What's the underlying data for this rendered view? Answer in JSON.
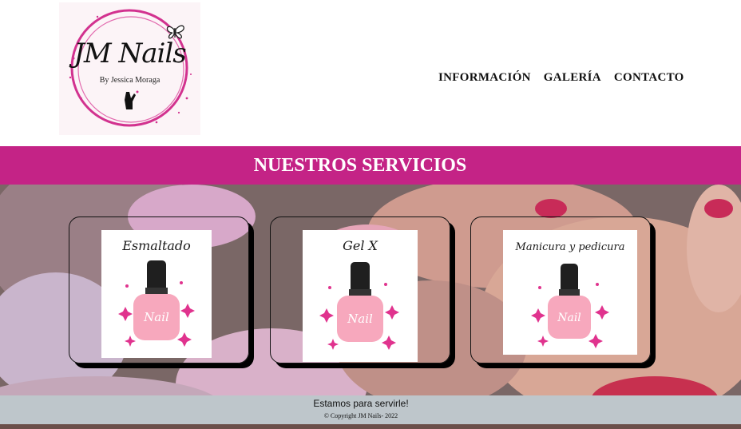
{
  "logo": {
    "title": "JM Nails",
    "subtitle": "By Jessica Moraga",
    "icons": [
      "butterfly-icon",
      "hand-icon"
    ]
  },
  "nav": {
    "items": [
      {
        "label": "INFORMACIÓN"
      },
      {
        "label": "GALERÍA"
      },
      {
        "label": "CONTACTO"
      }
    ]
  },
  "banner": {
    "title": "NUESTROS SERVICIOS"
  },
  "services": [
    {
      "label": "Esmaltado",
      "bottle_text": "Nail"
    },
    {
      "label": "Gel X",
      "bottle_text": "Nail"
    },
    {
      "label": "Manicura y pedicura",
      "bottle_text": "Nail"
    }
  ],
  "footer": {
    "message": "Estamos para servirle!",
    "copyright": "© Copyright JM Nails- 2022"
  },
  "colors": {
    "brand": "#c42386",
    "footer_bg": "#bec6cb",
    "bottle_pink": "#f7a8bd",
    "sparkle": "#e0338e"
  }
}
